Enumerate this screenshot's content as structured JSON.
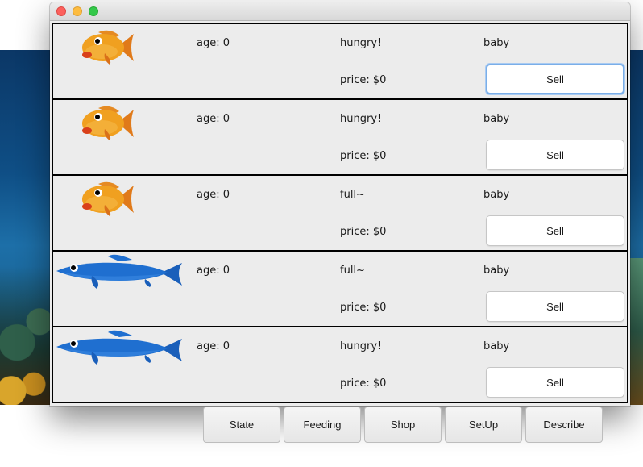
{
  "window": {
    "title": "",
    "controls": [
      "close",
      "minimize",
      "maximize"
    ]
  },
  "fish": [
    {
      "icon": "goldfish-icon",
      "age": "age: 0",
      "status": "hungry!",
      "stage": "baby",
      "price": "price: $0",
      "sell_label": "Sell",
      "focused": true
    },
    {
      "icon": "goldfish-icon",
      "age": "age: 0",
      "status": "hungry!",
      "stage": "baby",
      "price": "price: $0",
      "sell_label": "Sell",
      "focused": false
    },
    {
      "icon": "goldfish-icon",
      "age": "age: 0",
      "status": "full~",
      "stage": "baby",
      "price": "price: $0",
      "sell_label": "Sell",
      "focused": false
    },
    {
      "icon": "bluefish-icon",
      "age": "age: 0",
      "status": "full~",
      "stage": "baby",
      "price": "price: $0",
      "sell_label": "Sell",
      "focused": false
    },
    {
      "icon": "bluefish-icon",
      "age": "age: 0",
      "status": "hungry!",
      "stage": "baby",
      "price": "price: $0",
      "sell_label": "Sell",
      "focused": false
    }
  ],
  "toolbar": {
    "buttons": [
      "State",
      "Feeding",
      "Shop",
      "SetUp",
      "Describe"
    ]
  },
  "colors": {
    "goldfish": "#f0a020",
    "bluefish": "#1f6fd0",
    "focus_ring": "#7aaee8",
    "panel_bg": "#ececec"
  }
}
